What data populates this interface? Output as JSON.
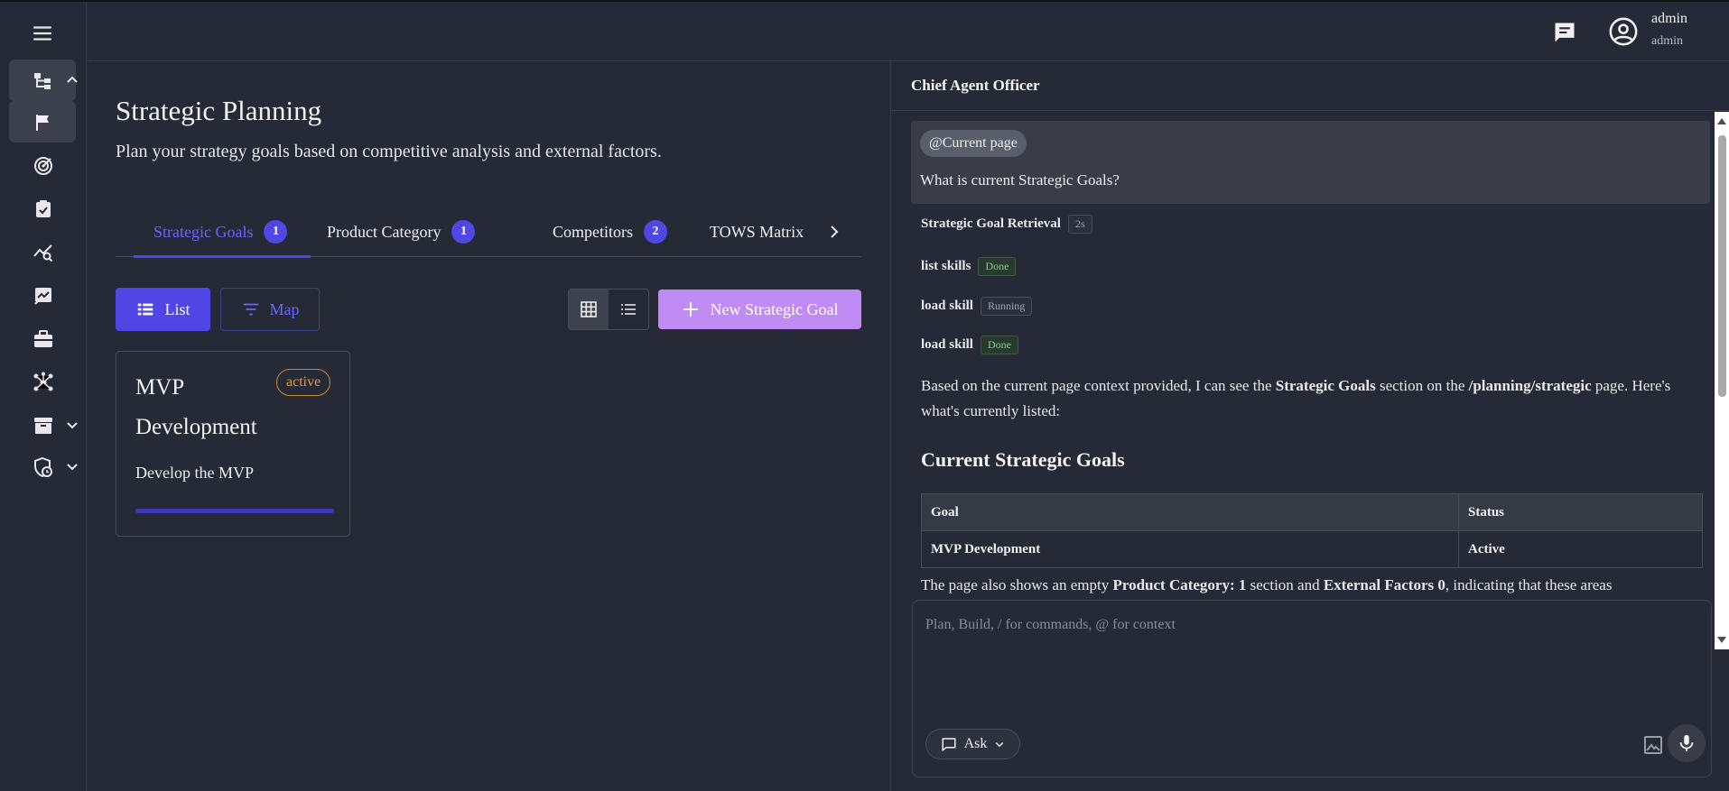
{
  "header": {
    "user_name": "admin",
    "user_role": "admin"
  },
  "sidebar": {
    "items": [
      {
        "icon": "hierarchy-icon",
        "has_chevron": true,
        "chevron": "up"
      },
      {
        "icon": "flag-icon",
        "active": true
      },
      {
        "icon": "target-icon"
      },
      {
        "icon": "clipboard-check-icon"
      },
      {
        "icon": "chart-search-icon"
      },
      {
        "icon": "chart-edit-icon"
      },
      {
        "icon": "briefcase-icon"
      },
      {
        "icon": "network-icon"
      },
      {
        "icon": "archive-icon",
        "has_chevron": true,
        "chevron": "down"
      },
      {
        "icon": "shield-clock-icon",
        "has_chevron": true,
        "chevron": "down"
      }
    ]
  },
  "main": {
    "title": "Strategic Planning",
    "subtitle": "Plan your strategy goals based on competitive analysis and external factors.",
    "tabs": [
      {
        "label": "Strategic Goals",
        "count": "1",
        "active": true
      },
      {
        "label": "Product Category",
        "count": "1"
      },
      {
        "label": "Competitors",
        "count": "2"
      },
      {
        "label": "TOWS Matrix",
        "count": ""
      }
    ],
    "toolbar": {
      "list_label": "List",
      "map_label": "Map",
      "new_label": "New Strategic Goal"
    },
    "goals": [
      {
        "title": "MVP Development",
        "status": "active",
        "description": "Develop the MVP",
        "progress": 1.0
      }
    ]
  },
  "chat": {
    "title": "Chief Agent Officer",
    "user_message": {
      "context_chip": "@Current page",
      "text": "What is current Strategic Goals?"
    },
    "steps": [
      {
        "label": "Strategic Goal Retrieval",
        "status": "2s"
      },
      {
        "label": "list skills",
        "status": "Done"
      },
      {
        "label": "load skill",
        "status": "Running"
      },
      {
        "label": "load skill",
        "status": "Done"
      }
    ],
    "response": {
      "intro_a": "Based on the current page context provided, I can see the ",
      "intro_b": "Strategic Goals",
      "intro_c": " section on the ",
      "intro_d": "/planning/strategic",
      "intro_e": " page. Here's what's currently listed:",
      "heading": "Current Strategic Goals",
      "table": {
        "headers": [
          "Goal",
          "Status"
        ],
        "rows": [
          [
            "MVP Development",
            "Active"
          ]
        ]
      },
      "trailing_a": "The page also shows an empty ",
      "trailing_b": "Product Category: 1",
      "trailing_c": " section and ",
      "trailing_d": "External Factors 0",
      "trailing_e": ", indicating that these areas"
    },
    "composer": {
      "placeholder": "Plan, Build, / for commands, @ for context",
      "mode_label": "Ask"
    }
  },
  "colors": {
    "background": "#262a36",
    "accent": "#4f46e5",
    "new_button": "#c08bf2",
    "status_active": "#e89a3c"
  }
}
